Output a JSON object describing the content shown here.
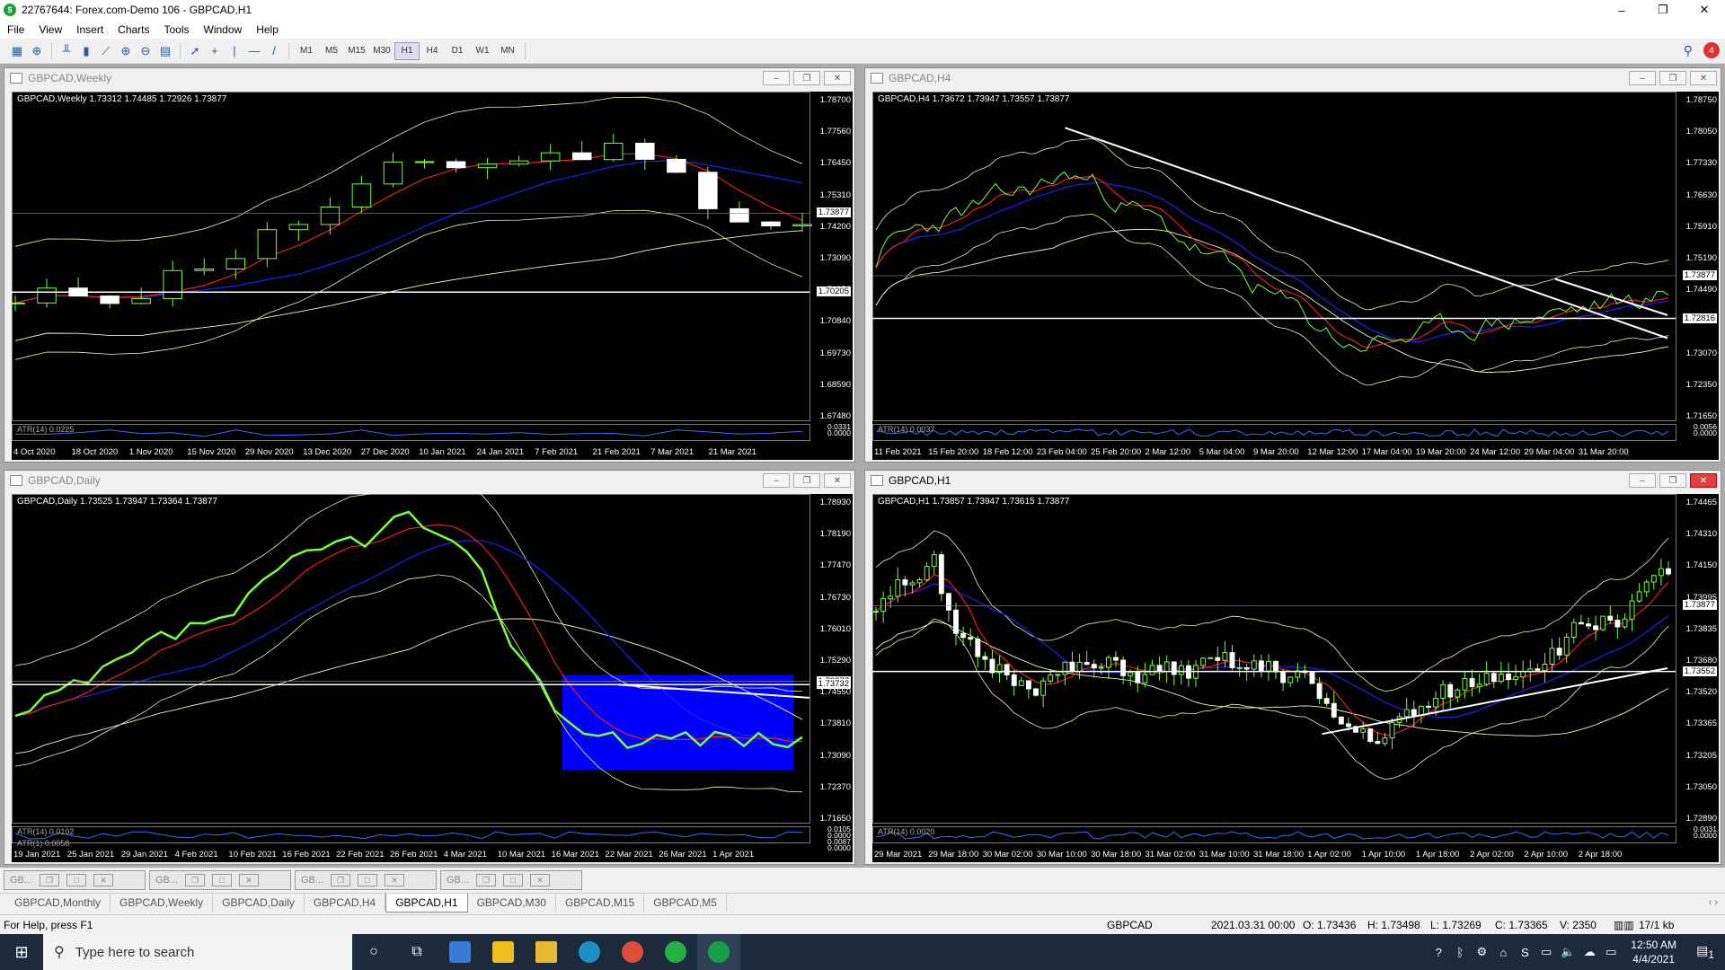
{
  "window": {
    "title": "22767644: Forex.com-Demo 106 - GBPCAD,H1",
    "controls": [
      "–",
      "❐",
      "✕"
    ]
  },
  "menu": [
    "File",
    "View",
    "Insert",
    "Charts",
    "Tools",
    "Window",
    "Help"
  ],
  "toolbar": {
    "timeframes": [
      "M1",
      "M5",
      "M15",
      "M30",
      "H1",
      "H4",
      "D1",
      "W1",
      "MN"
    ],
    "active_timeframe": "H1",
    "notifications": "4"
  },
  "charts": {
    "weekly": {
      "caption": "GBPCAD,Weekly",
      "header": "GBPCAD,Weekly  1.73312 1.74485 1.72926 1.73877",
      "prices": [
        "1.78700",
        "1.77560",
        "1.76450",
        "1.75310",
        "1.74200",
        "1.73090",
        "1.71950",
        "1.70840",
        "1.69730",
        "1.68590",
        "1.67480"
      ],
      "current_price": "1.73877",
      "level_price": "1.70205",
      "atr": "ATR(14) 0.0225",
      "atr_scale": [
        "0.0331",
        "0.0000"
      ],
      "dates": [
        "4 Oct 2020",
        "18 Oct 2020",
        "1 Nov 2020",
        "15 Nov 2020",
        "29 Nov 2020",
        "13 Dec 2020",
        "27 Dec 2020",
        "10 Jan 2021",
        "24 Jan 2021",
        "7 Feb 2021",
        "21 Feb 2021",
        "7 Mar 2021",
        "21 Mar 2021"
      ]
    },
    "h4": {
      "caption": "GBPCAD,H4",
      "header": "GBPCAD,H4  1.73672 1.73947 1.73557 1.73877",
      "prices": [
        "1.78750",
        "1.78050",
        "1.77330",
        "1.76630",
        "1.75910",
        "1.75190",
        "1.74490",
        "1.73770",
        "1.73070",
        "1.72350",
        "1.71650"
      ],
      "current_price": "1.73877",
      "level_price": "1.72816",
      "atr": "ATR(14) 0.0037",
      "atr_scale": [
        "0.0056",
        "0.0000"
      ],
      "dates": [
        "11 Feb 2021",
        "15 Feb 20:00",
        "18 Feb 12:00",
        "23 Feb 04:00",
        "25 Feb 20:00",
        "2 Mar 12:00",
        "5 Mar 04:00",
        "9 Mar 20:00",
        "12 Mar 12:00",
        "17 Mar 04:00",
        "19 Mar 20:00",
        "24 Mar 12:00",
        "29 Mar 04:00",
        "31 Mar 20:00"
      ]
    },
    "daily": {
      "caption": "GBPCAD,Daily",
      "header": "GBPCAD,Daily  1.73525 1.73947 1.73364 1.73877",
      "prices": [
        "1.78930",
        "1.78190",
        "1.77470",
        "1.76730",
        "1.76010",
        "1.75290",
        "1.74550",
        "1.73810",
        "1.73090",
        "1.72370",
        "1.71650"
      ],
      "current_price": "1.73877",
      "level_price": "1.73732",
      "atr": "ATR(14) 0.0102",
      "atr2": "ATR(1) 0.0058",
      "atr_scale": [
        "0.0105",
        "0.0000"
      ],
      "atr2_scale": [
        "0.0087",
        "0.0000"
      ],
      "dates": [
        "19 Jan 2021",
        "25 Jan 2021",
        "29 Jan 2021",
        "4 Feb 2021",
        "10 Feb 2021",
        "16 Feb 2021",
        "22 Feb 2021",
        "26 Feb 2021",
        "4 Mar 2021",
        "10 Mar 2021",
        "16 Mar 2021",
        "22 Mar 2021",
        "26 Mar 2021",
        "1 Apr 2021"
      ]
    },
    "h1": {
      "caption": "GBPCAD,H1",
      "header": "GBPCAD,H1  1.73857 1.73947 1.73615 1.73877",
      "prices": [
        "1.74465",
        "1.74310",
        "1.74150",
        "1.73995",
        "1.73835",
        "1.73680",
        "1.73520",
        "1.73365",
        "1.73205",
        "1.73050",
        "1.72890"
      ],
      "current_price": "1.73877",
      "level_price": "1.73552",
      "atr": "ATR(14) 0.0020",
      "atr_scale": [
        "0.0031",
        "0.0000"
      ],
      "dates": [
        "29 Mar 2021",
        "29 Mar 18:00",
        "30 Mar 02:00",
        "30 Mar 10:00",
        "30 Mar 18:00",
        "31 Mar 02:00",
        "31 Mar 10:00",
        "31 Mar 18:00",
        "1 Apr 02:00",
        "1 Apr 10:00",
        "1 Apr 18:00",
        "2 Apr 02:00",
        "2 Apr 10:00",
        "2 Apr 18:00"
      ]
    }
  },
  "minimized": [
    "GB...",
    "GB...",
    "GB...",
    "GB..."
  ],
  "chart_tabs": [
    "GBPCAD,Monthly",
    "GBPCAD,Weekly",
    "GBPCAD,Daily",
    "GBPCAD,H4",
    "GBPCAD,H1",
    "GBPCAD,M30",
    "GBPCAD,M15",
    "GBPCAD,M5"
  ],
  "active_tab": "GBPCAD,H1",
  "status": {
    "help": "For Help, press F1",
    "symbol": "GBPCAD",
    "datetime": "2021.03.31 00:00",
    "open": "O: 1.73436",
    "high": "H: 1.73498",
    "low": "L: 1.73269",
    "close": "C: 1.73365",
    "volume": "V: 2350",
    "traffic": "17/1 kb"
  },
  "taskbar": {
    "search_placeholder": "Type here to search",
    "time": "12:50 AM",
    "date": "4/4/2021",
    "notification_count": "1"
  },
  "colors": {
    "chart_bg": "#000000",
    "price_line": "#78ff3c",
    "ma_fast": "#ff2020",
    "ma_slow": "#2020ff",
    "band": "#d8ffb0",
    "highlight_box": "#0000ff"
  }
}
